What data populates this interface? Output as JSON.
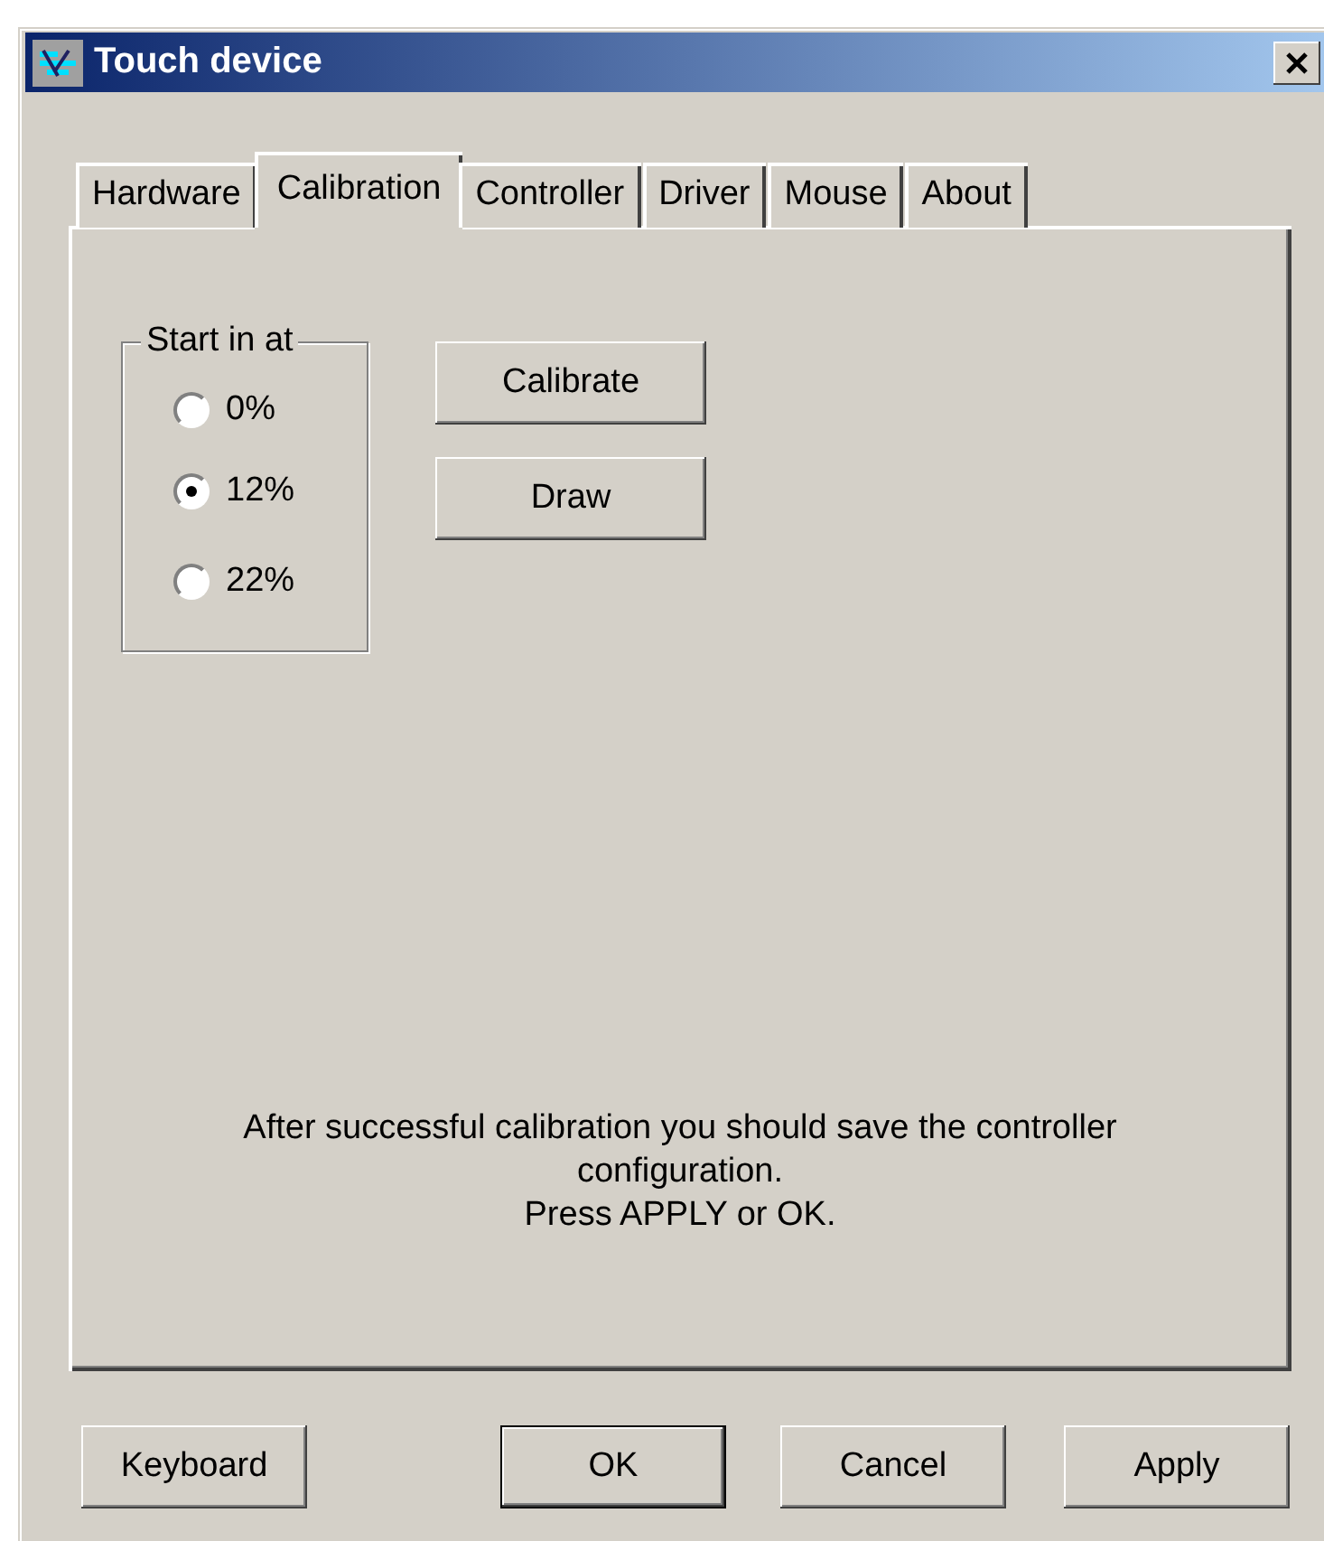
{
  "window": {
    "title": "Touch device"
  },
  "tabs": [
    {
      "label": "Hardware",
      "selected": false
    },
    {
      "label": "Calibration",
      "selected": true
    },
    {
      "label": "Controller",
      "selected": false
    },
    {
      "label": "Driver",
      "selected": false
    },
    {
      "label": "Mouse",
      "selected": false
    },
    {
      "label": "About",
      "selected": false
    }
  ],
  "start_group": {
    "label": "Start in at",
    "options": [
      {
        "label": "0%",
        "selected": false
      },
      {
        "label": "12%",
        "selected": true
      },
      {
        "label": "22%",
        "selected": false
      }
    ]
  },
  "actions": [
    "Calibrate",
    "Draw"
  ],
  "message": "After successful calibration you should save the controller configuration.\nPress APPLY or OK.",
  "buttons": [
    {
      "label": "Keyboard",
      "default": false
    },
    {
      "label": "OK",
      "default": true
    },
    {
      "label": "Cancel",
      "default": false
    },
    {
      "label": "Apply",
      "default": false
    }
  ]
}
